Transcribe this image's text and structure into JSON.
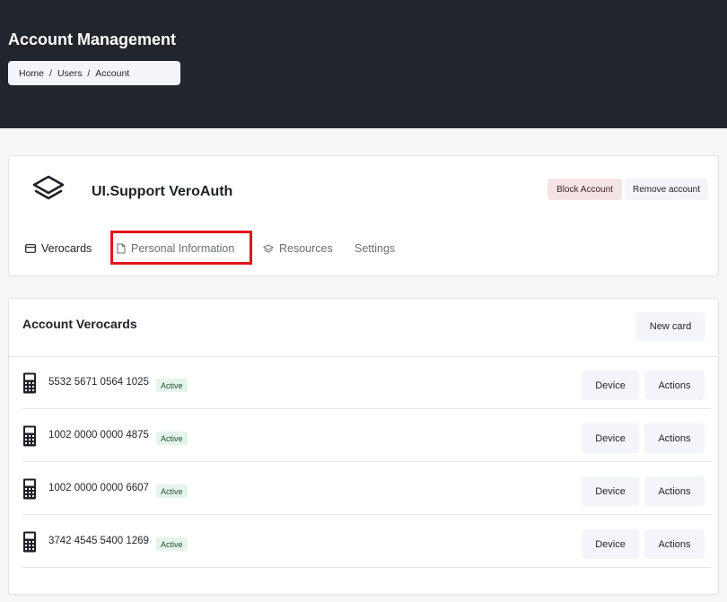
{
  "header": {
    "title": "Account Management",
    "breadcrumb": [
      "Home",
      "Users",
      "Account"
    ],
    "breadcrumb_separator": "/"
  },
  "account": {
    "name": "UI.Support VeroAuth",
    "logo_icon": "layers-stack-icon",
    "block_label": "Block Account",
    "remove_label": "Remove account"
  },
  "tabs": [
    {
      "label": "Verocards",
      "icon": "card-icon",
      "active": true
    },
    {
      "label": "Personal Information",
      "icon": "document-icon",
      "active": false,
      "highlighted": true
    },
    {
      "label": "Resources",
      "icon": "layers-icon",
      "active": false
    },
    {
      "label": "Settings",
      "icon": "",
      "active": false
    }
  ],
  "verocards": {
    "title": "Account Verocards",
    "new_label": "New card",
    "rows": [
      {
        "number": "5532 5671 0564 1025",
        "status": "Active",
        "device_label": "Device",
        "actions_label": "Actions"
      },
      {
        "number": "1002 0000 0000 4875",
        "status": "Active",
        "device_label": "Device",
        "actions_label": "Actions"
      },
      {
        "number": "1002 0000 0000 6607",
        "status": "Active",
        "device_label": "Device",
        "actions_label": "Actions"
      },
      {
        "number": "3742 4545 5400 1269",
        "status": "Active",
        "device_label": "Device",
        "actions_label": "Actions"
      }
    ]
  },
  "colors": {
    "header_bg": "#22252b",
    "highlight": "#e0141e",
    "badge_bg": "#e6f5ec",
    "block_bg": "#f4e4e6"
  }
}
